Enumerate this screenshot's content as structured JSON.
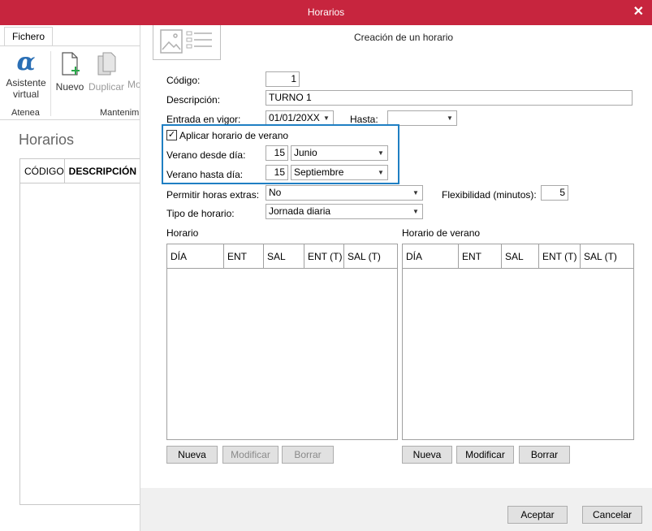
{
  "window": {
    "title": "Horarios"
  },
  "ribbon": {
    "tab_fichero": "Fichero",
    "asistente_label_1": "Asistente",
    "asistente_label_2": "virtual",
    "nuevo_label": "Nuevo",
    "duplicar_label": "Duplicar",
    "mo_label": "Mo",
    "group_atenea": "Atenea",
    "group_mantenimiento": "Mantenim",
    "accent_color": "#1f6fb0"
  },
  "left_panel": {
    "title": "Horarios",
    "columns": [
      "CÓDIGO",
      "DESCRIPCIÓN"
    ]
  },
  "dialog": {
    "heading": "Creación de un horario",
    "codigo_label": "Código:",
    "codigo_value": "1",
    "descripcion_label": "Descripción:",
    "descripcion_value": "TURNO 1",
    "entrada_label": "Entrada en vigor:",
    "entrada_value": "01/01/20XX",
    "hasta_label": "Hasta:",
    "hasta_value": "",
    "aplicar_verano_label": "Aplicar horario de verano",
    "aplicar_verano_checked": true,
    "verano_desde_label": "Verano desde día:",
    "verano_desde_dia": "15",
    "verano_desde_mes": "Junio",
    "verano_hasta_label": "Verano hasta día:",
    "verano_hasta_dia": "15",
    "verano_hasta_mes": "Septiembre",
    "horas_extras_label": "Permitir horas extras:",
    "horas_extras_value": "No",
    "flexibilidad_label": "Flexibilidad (minutos):",
    "flexibilidad_value": "5",
    "tipo_label": "Tipo de horario:",
    "tipo_value": "Jornada diaria",
    "horario_label": "Horario",
    "horario_verano_label": "Horario de verano",
    "grid_columns": [
      "DÍA",
      "ENT",
      "SAL",
      "ENT (T)",
      "SAL (T)"
    ],
    "btn_nueva": "Nueva",
    "btn_modificar": "Modificar",
    "btn_borrar": "Borrar",
    "btn_aceptar": "Aceptar",
    "btn_cancelar": "Cancelar",
    "highlight_color": "#1f7fc3"
  }
}
